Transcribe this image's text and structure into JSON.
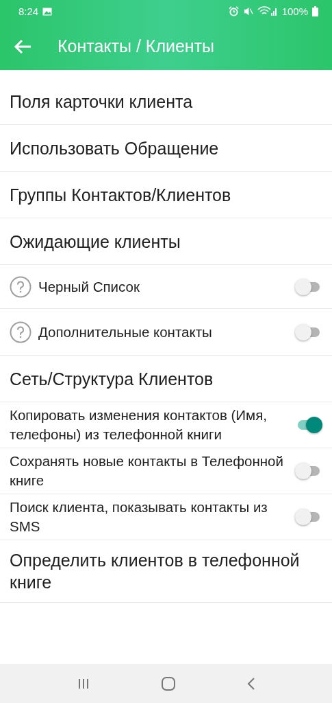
{
  "status_bar": {
    "time": "8:24",
    "battery": "100%"
  },
  "toolbar": {
    "title": "Контакты / Клиенты"
  },
  "items": [
    {
      "kind": "link",
      "label": "Поля карточки клиента"
    },
    {
      "kind": "link",
      "label": "Использовать Обращение"
    },
    {
      "kind": "link",
      "label": "Группы Контактов/Клиентов"
    },
    {
      "kind": "link",
      "label": "Ожидающие клиенты"
    },
    {
      "kind": "help_toggle",
      "label": "Черный Список",
      "on": false
    },
    {
      "kind": "help_toggle",
      "label": "Дополнительные контакты",
      "on": false
    },
    {
      "kind": "link",
      "label": "Сеть/Структура Клиентов"
    },
    {
      "kind": "toggle",
      "label": "Копировать изменения контактов (Имя, телефоны) из телефонной книги",
      "on": true
    },
    {
      "kind": "toggle",
      "label": "Сохранять новые контакты в Телефонной книге",
      "on": false
    },
    {
      "kind": "toggle",
      "label": "Поиск клиента, показывать контакты из SMS",
      "on": false
    },
    {
      "kind": "link",
      "label": "Определить клиентов в телефонной книге"
    }
  ]
}
